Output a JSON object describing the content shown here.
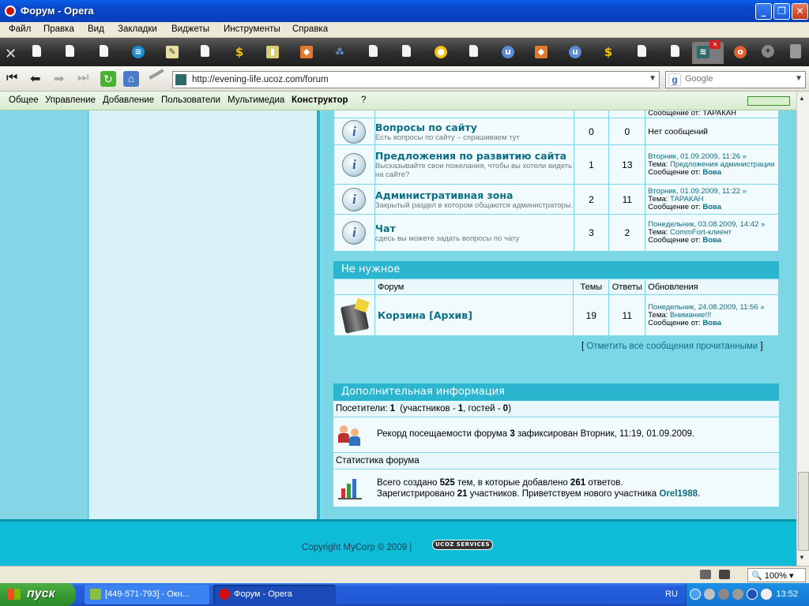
{
  "window": {
    "title": "Форум - Opera"
  },
  "menu": [
    "Файл",
    "Правка",
    "Вид",
    "Закладки",
    "Виджеты",
    "Инструменты",
    "Справка"
  ],
  "address": {
    "url": "http://evening-life.ucoz.com/forum",
    "search_placeholder": "Google"
  },
  "ucoz_panel": [
    "Общее",
    "Управление",
    "Добавление",
    "Пользователи",
    "Мультимедиа",
    "Конструктор",
    "?"
  ],
  "forums": [
    {
      "top_partial": "Сообщение от: ТАРАКАН",
      "name": "Вопросы по сайту",
      "desc": "Есть вопросы по сайту – спрашиваем тут",
      "threads": "0",
      "replies": "0",
      "update": "Нет сообщений"
    },
    {
      "name": "Предложения по развитию сайта",
      "desc": "Высказывайте свои пожелания, чтобы вы хотели видеть на сайте?",
      "threads": "1",
      "replies": "13",
      "date": "Вторник, 01.09.2009, 11:26",
      "topic_label": "Тема:",
      "topic": "Предложения администрации",
      "from_label": "Сообщение от:",
      "author": "Вова"
    },
    {
      "name": "Административная зона",
      "desc": "Закрытый раздел в котором общаются администраторы.",
      "threads": "2",
      "replies": "11",
      "date": "Вторник, 01.09.2009, 11:22",
      "topic_label": "Тема:",
      "topic": "ТАРАКАН",
      "from_label": "Сообщение от:",
      "author": "Вова"
    },
    {
      "name": "Чат",
      "desc": "сдесь вы можете задать вопросы по чату",
      "threads": "3",
      "replies": "2",
      "date": "Понедельник, 03.08.2009, 14:42",
      "topic_label": "Тема:",
      "topic": "CommFort-клиент",
      "from_label": "Сообщение от:",
      "author": "Вова"
    }
  ],
  "unneeded": {
    "title": "Не нужное",
    "col_forum": "Форум",
    "col_threads": "Темы",
    "col_replies": "Ответы",
    "col_updates": "Обновления",
    "forum": {
      "name": "Корзина [Архив]",
      "threads": "19",
      "replies": "11",
      "date": "Понедельник, 24.08.2009, 11:56",
      "topic_label": "Тема:",
      "topic": "Внимание!!!",
      "from_label": "Сообщение от:",
      "author": "Вова"
    }
  },
  "mark_read": "Отметить все сообщения прочитанными",
  "info": {
    "title": "Дополнительная информация",
    "visitors_label": "Посетители:",
    "visitors": "1",
    "members_label": "(участников -",
    "members": "1",
    "guests_label": ", гостей -",
    "guests": "0",
    "record_prefix": "Рекорд посещаемости форума",
    "record_value": "3",
    "record_suffix": "зафиксирован Вторник, 11:19, 01.09.2009.",
    "stats_label": "Статистика форума",
    "stats_line1_a": "Всего создано",
    "stats_topics": "525",
    "stats_line1_b": "тем, в которые добавлено",
    "stats_posts": "261",
    "stats_line1_c": "ответов.",
    "stats_line2_a": "Зарегистрировано",
    "stats_users": "21",
    "stats_line2_b": "участников. Приветствуем нового участника",
    "stats_newuser": "Orel1988"
  },
  "footer": {
    "copyright": "Copyright MyCorp © 2009 |",
    "badge": "UCOZ SERVICES"
  },
  "status": {
    "zoom": "100%"
  },
  "taskbar": {
    "start": "пуск",
    "tasks": [
      "[449-571-793] - Окн...",
      "Форум - Opera"
    ],
    "lang": "RU",
    "clock": "13:52"
  }
}
